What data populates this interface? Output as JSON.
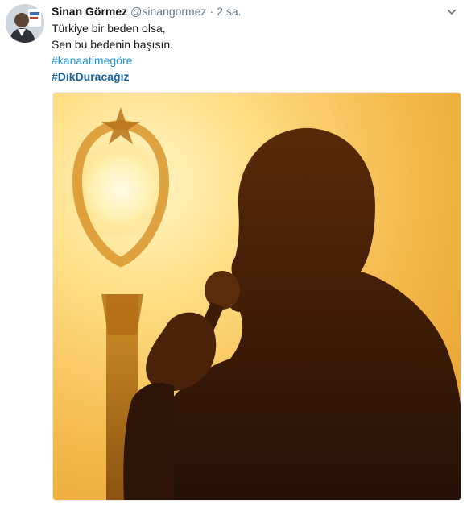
{
  "tweet": {
    "author": {
      "display_name": "Sinan Görmez",
      "handle": "@sinangormez",
      "avatar_icon": "user-avatar"
    },
    "separator": "·",
    "timestamp": "2 sa.",
    "menu_icon": "chevron-down-icon",
    "text_lines": [
      "Türkiye bir beden olsa,",
      "Sen bu bedenin başısın."
    ],
    "hashtags": [
      "#kanaatimegöre",
      "#DikDuracağız"
    ],
    "media": {
      "icon": "photo-silhouette-sunset"
    }
  },
  "colors": {
    "link": "#1b95e0",
    "bold_link": "#1c6399",
    "secondary_text": "#657786",
    "primary_text": "#14171a",
    "sunset_light": "#ffe69a",
    "sunset_dark": "#e08a1c"
  }
}
